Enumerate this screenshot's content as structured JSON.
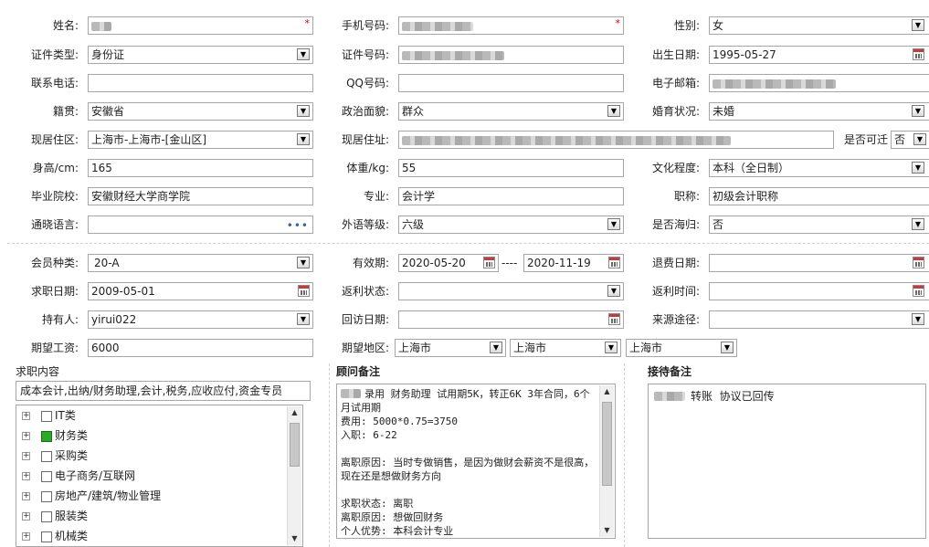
{
  "personal": {
    "name_label": "姓名:",
    "phone_label": "手机号码:",
    "gender_label": "性别:",
    "gender_value": "女",
    "id_type_label": "证件类型:",
    "id_type_value": "身份证",
    "id_number_label": "证件号码:",
    "birth_label": "出生日期:",
    "birth_value": "1995-05-27",
    "tel_label": "联系电话:",
    "qq_label": "QQ号码:",
    "email_label": "电子邮箱:",
    "native_label": "籍贯:",
    "native_value": "安徽省",
    "political_label": "政治面貌:",
    "political_value": "群众",
    "marital_label": "婚育状况:",
    "marital_value": "未婚",
    "residence_area_label": "现居住区:",
    "residence_area_value": "上海市-上海市-[金山区]",
    "residence_addr_label": "现居住址:",
    "relocate_label": "是否可迁",
    "relocate_value": "否",
    "height_label": "身高/cm:",
    "height_value": "165",
    "weight_label": "体重/kg:",
    "weight_value": "55",
    "education_label": "文化程度:",
    "education_value": "本科（全日制）",
    "school_label": "毕业院校:",
    "school_value": "安徽财经大学商学院",
    "major_label": "专业:",
    "major_value": "会计学",
    "title_label": "职称:",
    "title_value": "初级会计职称",
    "language_label": "通晓语言:",
    "language_dots": "•••",
    "foreign_level_label": "外语等级:",
    "foreign_level_value": "六级",
    "overseas_label": "是否海归:",
    "overseas_value": "否",
    "required_mark": "*"
  },
  "membership": {
    "member_type_label": "会员种类:",
    "member_type_value": "20-A",
    "validity_label": "有效期:",
    "validity_start": "2020-05-20",
    "validity_sep": "----",
    "validity_end": "2020-11-19",
    "refund_date_label": "退费日期:",
    "job_date_label": "求职日期:",
    "job_date_value": "2009-05-01",
    "rebate_status_label": "返利状态:",
    "rebate_time_label": "返利时间:",
    "holder_label": "持有人:",
    "holder_value": "yirui022",
    "visit_date_label": "回访日期:",
    "source_label": "来源途径:",
    "salary_label": "期望工资:",
    "salary_value": "6000",
    "region_label": "期望地区:",
    "region_1": "上海市",
    "region_2": "上海市",
    "region_3": "上海市"
  },
  "job_content": {
    "label": "求职内容",
    "summary": "成本会计,出纳/财务助理,会计,税务,应收应付,资金专员",
    "tree": [
      {
        "label": "IT类",
        "checked": false
      },
      {
        "label": "财务类",
        "checked": true
      },
      {
        "label": "采购类",
        "checked": false
      },
      {
        "label": "电子商务/互联网",
        "checked": false
      },
      {
        "label": "房地产/建筑/物业管理",
        "checked": false
      },
      {
        "label": "服装类",
        "checked": false
      },
      {
        "label": "机械类",
        "checked": false
      }
    ],
    "expander_glyph": "+"
  },
  "advisor_notes": {
    "label": "顾问备注",
    "text": "录用 财务助理 试用期5K，转正6K 3年合同，6个月试用期\n费用: 5000*0.75=3750\n入职: 6-22\n\n离职原因: 当时专做销售，是因为做财会薪资不是很高，现在还是想做财务方向\n\n求职状态: 离职\n离职原因: 想做回财务\n个人优势: 本科会计专业"
  },
  "reception_notes": {
    "label": "接待备注",
    "text": "转账  协议已回传"
  },
  "icons": {
    "dropdown": "▼",
    "scroll_up": "▲",
    "scroll_down": "▼"
  }
}
